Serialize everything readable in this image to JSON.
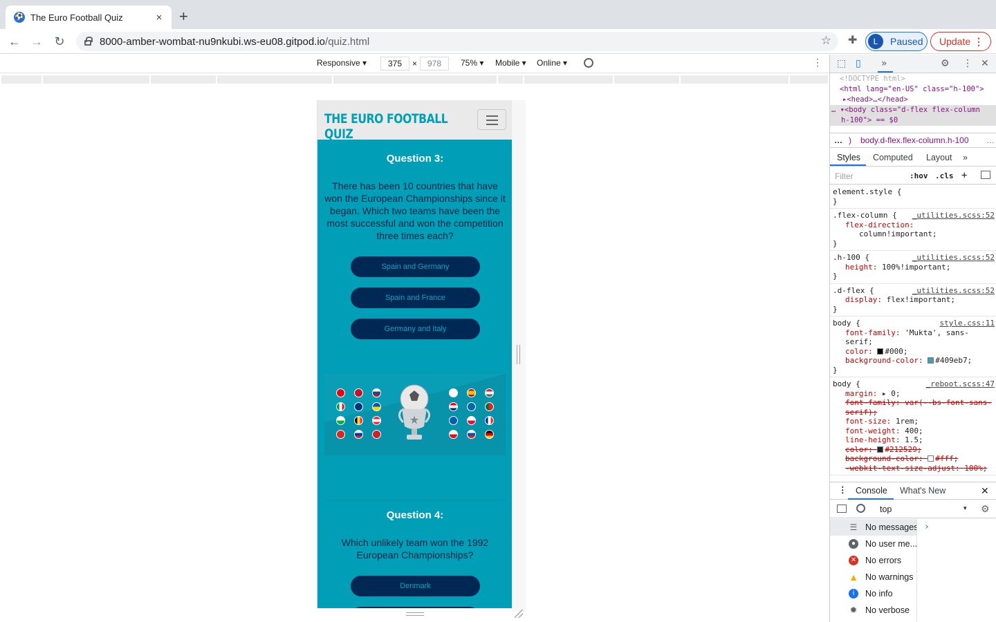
{
  "browser": {
    "tab_title": "The Euro Football Quiz",
    "tab_close": "×",
    "new_tab": "+",
    "url_host": "8000-amber-wombat-nu9nkubi.ws-eu08.gitpod.io",
    "url_path": "/quiz.html",
    "profile_initial": "L",
    "profile_label": "Paused",
    "update_label": "Update"
  },
  "device_toolbar": {
    "mode": "Responsive ▾",
    "width": "375",
    "times": "×",
    "height": "978",
    "zoom": "75% ▾",
    "device_type": "Mobile ▾",
    "throttling": "Online ▾"
  },
  "site": {
    "brand": "THE EURO FOOTBALL QUIZ",
    "questions": [
      {
        "title": "Question 3:",
        "text": "There has been 10 countries that have won the European Championships since it began. Which two teams have been the most successful and won the competition three times each?",
        "answers": [
          "Spain and Germany",
          "Spain and France",
          "Germany and Italy"
        ]
      },
      {
        "title": "Question 4:",
        "text": "Which unlikely team won the 1992 European Championships?",
        "answers": [
          "Denmark"
        ]
      }
    ]
  },
  "devtools": {
    "dom": {
      "doctype": "<!DOCTYPE html>",
      "html_open": "<html lang=\"en-US\" class=\"h-100\">",
      "head": "<head>…</head>",
      "body_open_1": "<body class=\"d-flex flex-column",
      "body_open_2": "h-100\"> == $0"
    },
    "breadcrumb": "body.d-flex.flex-column.h-100",
    "tabs": [
      "Styles",
      "Computed",
      "Layout"
    ],
    "filter_placeholder": "Filter",
    "hov": ":hov",
    "cls": ".cls",
    "rules": [
      {
        "selector": "element.style {",
        "source": "",
        "props": []
      },
      {
        "selector": ".flex-column {",
        "source": "_utilities.scss:52",
        "props": [
          [
            "flex-direction:",
            "column!important;"
          ]
        ]
      },
      {
        "selector": ".h-100 {",
        "source": "_utilities.scss:52",
        "props": [
          [
            "height:",
            "100%!important;"
          ]
        ]
      },
      {
        "selector": ".d-flex {",
        "source": "_utilities.scss:52",
        "props": [
          [
            "display:",
            "flex!important;"
          ]
        ]
      },
      {
        "selector": "body {",
        "source": "style.css:11",
        "props": [
          [
            "font-family:",
            "'Mukta', sans-serif;"
          ],
          [
            "color:",
            "#000;"
          ],
          [
            "background-color:",
            "#409eb7;"
          ]
        ]
      },
      {
        "selector": "body {",
        "source": "_reboot.scss:47",
        "props": [
          [
            "margin:",
            "▸ 0;"
          ],
          [
            "font-family:",
            "var(--bs-font-sans-serif);"
          ],
          [
            "font-size:",
            "1rem;"
          ],
          [
            "font-weight:",
            "400;"
          ],
          [
            "line-height:",
            "1.5;"
          ],
          [
            "color:",
            "#212529;"
          ],
          [
            "background-color:",
            "#fff;"
          ],
          [
            "-webkit-text-size-adjust:",
            "100%;"
          ]
        ]
      }
    ],
    "console_tabs": [
      "Console",
      "What's New"
    ],
    "context": "top",
    "messages": [
      "No messages",
      "No user me...",
      "No errors",
      "No warnings",
      "No info",
      "No verbose"
    ]
  },
  "colors": {
    "page_bg": "#009eb7",
    "button_bg": "#002855",
    "brand": "#009eb7"
  }
}
